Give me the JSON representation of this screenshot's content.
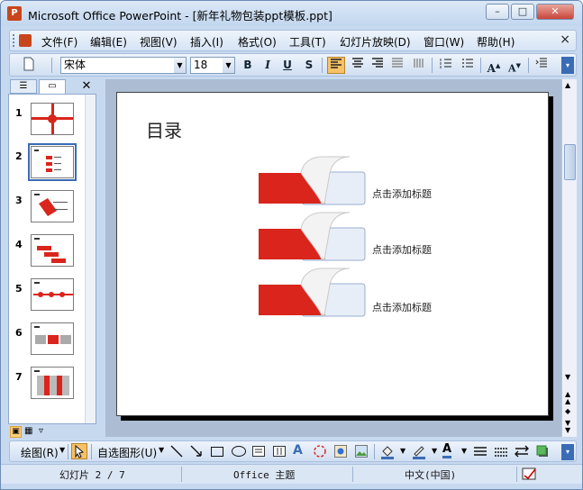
{
  "window": {
    "title": "Microsoft Office PowerPoint - [新年礼物包装ppt模板.ppt]",
    "minimize": "–",
    "restore": "□",
    "close": "✕"
  },
  "menu": {
    "items": [
      "文件(F)",
      "编辑(E)",
      "视图(V)",
      "插入(I)",
      "格式(O)",
      "工具(T)",
      "幻灯片放映(D)",
      "窗口(W)",
      "帮助(H)"
    ],
    "close": "×"
  },
  "format_toolbar": {
    "font": "宋体",
    "size": "18",
    "bold": "B",
    "italic": "I",
    "underline": "U",
    "shadow": "S"
  },
  "outline": {
    "slides": [
      "1",
      "2",
      "3",
      "4",
      "5",
      "6",
      "7"
    ],
    "selected_index": 2
  },
  "slide": {
    "title": "目录",
    "items": [
      "点击添加标题",
      "点击添加标题",
      "点击添加标题"
    ]
  },
  "draw_toolbar": {
    "draw_label": "绘图(R)",
    "autoshape_label": "自选图形(U)"
  },
  "status": {
    "slide_info": "幻灯片 2 / 7",
    "theme": "Office 主题",
    "language": "中文(中国)"
  },
  "colors": {
    "accent_red": "#d9251c",
    "title_bar": "#c2d6ee",
    "selection": "#3a6cb5"
  }
}
